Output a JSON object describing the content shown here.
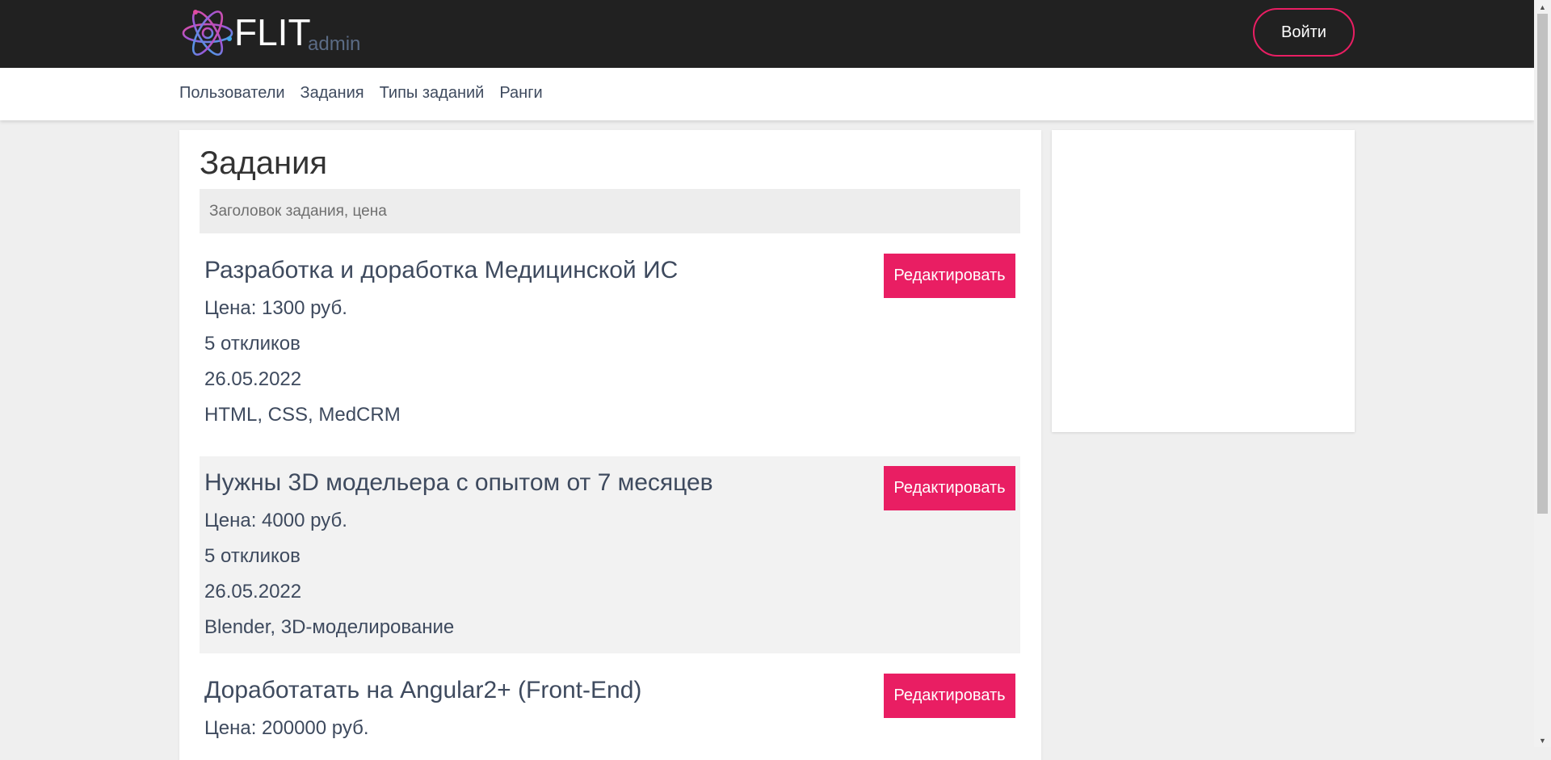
{
  "header": {
    "brand": "FLIT",
    "brand_sub": "admin",
    "login_label": "Войти"
  },
  "nav": {
    "items": [
      {
        "label": "Пользователи"
      },
      {
        "label": "Задания"
      },
      {
        "label": "Типы заданий"
      },
      {
        "label": "Ранги"
      }
    ]
  },
  "main": {
    "title": "Задания",
    "search_placeholder": "Заголовок задания, цена",
    "edit_label": "Редактировать",
    "tasks": [
      {
        "title": "Разработка и доработка Медицинской ИС",
        "price": "Цена: 1300 руб.",
        "responses": "5 откликов",
        "date": "26.05.2022",
        "tags": "HTML, CSS, MedCRM"
      },
      {
        "title": "Нужны 3D модельера с опытом от 7 месяцев",
        "price": "Цена: 4000 руб.",
        "responses": "5 откликов",
        "date": "26.05.2022",
        "tags": "Blender, 3D-моделирование"
      },
      {
        "title": "Доработатать на Angular2+ (Front-End)",
        "price": "Цена: 200000 руб."
      }
    ]
  },
  "colors": {
    "accent": "#e91e63",
    "header_bg": "#212121",
    "text": "#3e4a5e",
    "page_bg": "#efefef"
  },
  "icons": {
    "logo": "atom-logo-icon"
  }
}
